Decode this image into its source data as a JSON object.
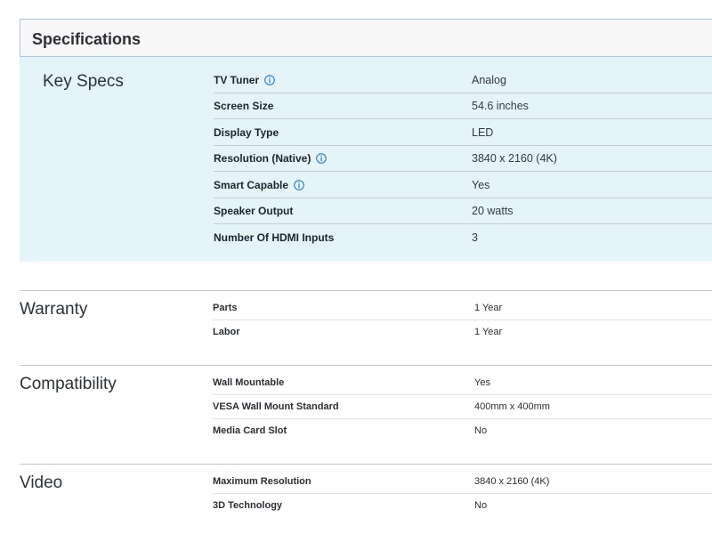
{
  "header": {
    "title": "Specifications"
  },
  "key_specs": {
    "title": "Key Specs",
    "rows": [
      {
        "label": "TV Tuner",
        "value": "Analog",
        "info_icon": "info-icon"
      },
      {
        "label": "Screen Size",
        "value": "54.6 inches"
      },
      {
        "label": "Display Type",
        "value": "LED"
      },
      {
        "label": "Resolution (Native)",
        "value": "3840 x 2160 (4K)",
        "info_icon": "info-icon"
      },
      {
        "label": "Smart Capable",
        "value": "Yes",
        "info_icon": "info-icon"
      },
      {
        "label": "Speaker Output",
        "value": "20 watts"
      },
      {
        "label": "Number Of HDMI Inputs",
        "value": "3"
      }
    ]
  },
  "warranty": {
    "title": "Warranty",
    "rows": [
      {
        "label": "Parts",
        "value": "1 Year"
      },
      {
        "label": "Labor",
        "value": "1 Year"
      }
    ]
  },
  "compatibility": {
    "title": "Compatibility",
    "rows": [
      {
        "label": "Wall Mountable",
        "value": "Yes"
      },
      {
        "label": "VESA Wall Mount Standard",
        "value": "400mm x 400mm"
      },
      {
        "label": "Media Card Slot",
        "value": "No"
      }
    ]
  },
  "video": {
    "title": "Video",
    "rows": [
      {
        "label": "Maximum Resolution",
        "value": "3840 x 2160 (4K)"
      },
      {
        "label": "3D Technology",
        "value": "No"
      }
    ]
  },
  "colors": {
    "accent_border": "#a9c6e6",
    "key_specs_bg": "#e5f4f8",
    "info_icon": "#1b70c8"
  }
}
